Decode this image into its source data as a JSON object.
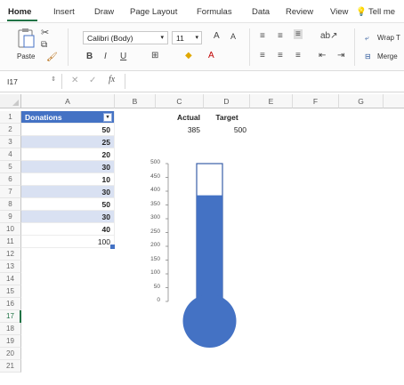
{
  "ribbon_tabs": [
    {
      "label": "Home"
    },
    {
      "label": "Insert"
    },
    {
      "label": "Draw"
    },
    {
      "label": "Page Layout"
    },
    {
      "label": "Formulas"
    },
    {
      "label": "Data"
    },
    {
      "label": "Review"
    },
    {
      "label": "View"
    },
    {
      "label": "Tell me"
    }
  ],
  "ribbon": {
    "paste_label": "Paste",
    "font_name": "Calibri (Body)",
    "font_size": "11",
    "bold": "B",
    "italic": "I",
    "underline": "U",
    "increase_font": "A",
    "decrease_font": "A",
    "wrap_text": "Wrap T",
    "merge": "Merge"
  },
  "formula_bar": {
    "name_box": "I17",
    "fx": "fx",
    "content": ""
  },
  "columns": [
    "A",
    "B",
    "C",
    "D",
    "E",
    "F",
    "G"
  ],
  "rows": [
    "1",
    "2",
    "3",
    "4",
    "5",
    "6",
    "7",
    "8",
    "9",
    "10",
    "11",
    "12",
    "13",
    "14",
    "15",
    "16",
    "17",
    "18",
    "19",
    "20",
    "21"
  ],
  "table": {
    "header": "Donations",
    "filter_icon": "▾",
    "values": [
      "50",
      "25",
      "20",
      "30",
      "10",
      "30",
      "50",
      "30",
      "40",
      "100"
    ]
  },
  "summary": {
    "actual_label": "Actual",
    "target_label": "Target",
    "actual_value": "385",
    "target_value": "500"
  },
  "chart_data": {
    "type": "bar",
    "categories": [
      ""
    ],
    "series": [
      {
        "values": [
          385
        ]
      }
    ],
    "target": 500,
    "ylim": [
      0,
      500
    ],
    "yticks": [
      "500",
      "450",
      "400",
      "350",
      "300",
      "250",
      "200",
      "150",
      "100",
      "50",
      "0"
    ],
    "title": "",
    "xlabel": "",
    "ylabel": "",
    "fill_color": "#4472c4"
  },
  "colors": {
    "accent": "#217346",
    "table_header": "#4472c4",
    "band": "#d9e1f2"
  }
}
